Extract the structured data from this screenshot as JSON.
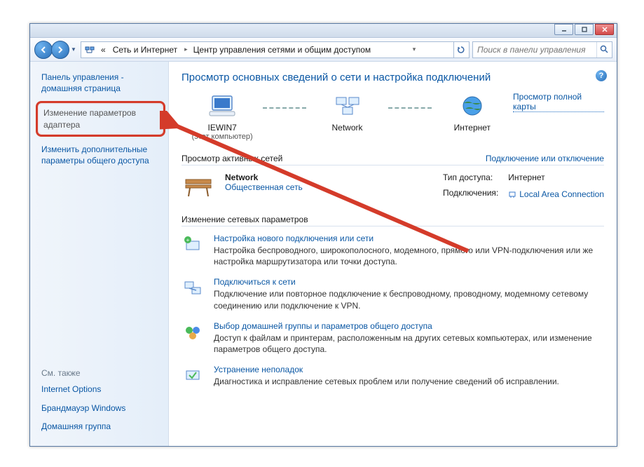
{
  "titlebar": {},
  "nav": {
    "breadcrumb_prefix": "«",
    "segments": [
      "Сеть и Интернет",
      "Центр управления сетями и общим доступом"
    ],
    "search_placeholder": "Поиск в панели управления"
  },
  "sidebar": {
    "cp_home": "Панель управления -\nдомашняя страница",
    "highlighted": "Изменение параметров\nадаптера",
    "link2": "Изменить дополнительные\nпараметры общего доступа",
    "see_also_header": "См. также",
    "see_also": [
      "Internet Options",
      "Брандмауэр Windows",
      "Домашняя группа"
    ]
  },
  "content": {
    "page_title": "Просмотр основных сведений о сети и настройка подключений",
    "map": {
      "computer": "IEWIN7",
      "computer_sub": "(этот компьютер)",
      "network": "Network",
      "internet": "Интернет",
      "full_map_link": "Просмотр полной карты"
    },
    "active_networks": {
      "header": "Просмотр активных сетей",
      "toggle_link": "Подключение или отключение",
      "name": "Network",
      "type": "Общественная сеть",
      "access_label": "Тип доступа:",
      "access_value": "Интернет",
      "connections_label": "Подключения:",
      "connections_value": "Local Area Connection"
    },
    "change_settings": {
      "header": "Изменение сетевых параметров",
      "tasks": [
        {
          "title": "Настройка нового подключения или сети",
          "desc": "Настройка беспроводного, широкополосного, модемного, прямого или VPN-подключения или же настройка маршрутизатора или точки доступа."
        },
        {
          "title": "Подключиться к сети",
          "desc": "Подключение или повторное подключение к беспроводному, проводному, модемному сетевому соединению или подключение к VPN."
        },
        {
          "title": "Выбор домашней группы и параметров общего доступа",
          "desc": "Доступ к файлам и принтерам, расположенным на других сетевых компьютерах, или изменение параметров общего доступа."
        },
        {
          "title": "Устранение неполадок",
          "desc": "Диагностика и исправление сетевых проблем или получение сведений об исправлении."
        }
      ]
    }
  }
}
